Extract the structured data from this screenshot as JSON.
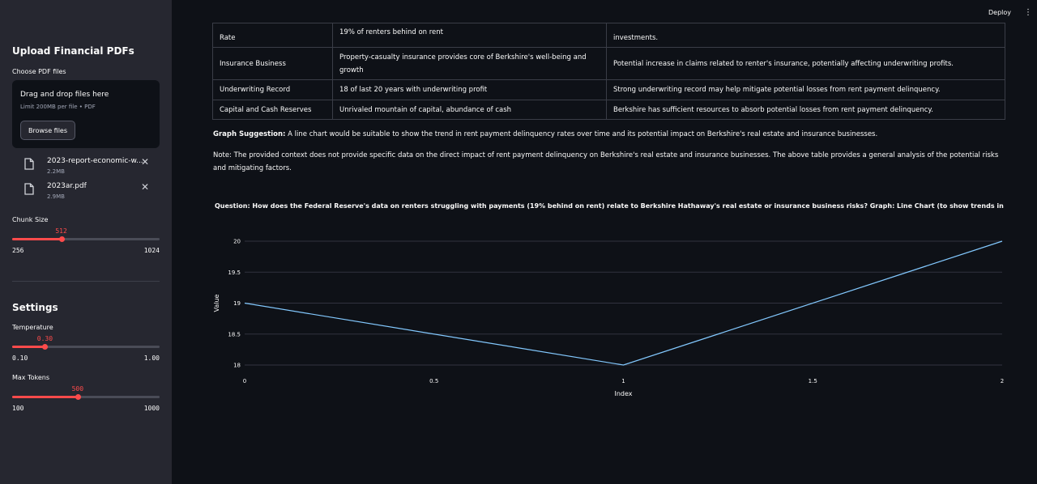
{
  "header": {
    "deploy_label": "Deploy",
    "menu_icon": "kebab-menu-icon"
  },
  "sidebar": {
    "title": "Upload Financial PDFs",
    "uploader": {
      "label": "Choose PDF files",
      "drop_text": "Drag and drop files here",
      "limit_text": "Limit 200MB per file • PDF",
      "browse_label": "Browse files"
    },
    "files": [
      {
        "name": "2023-report-economic-w...",
        "size": "2.2MB"
      },
      {
        "name": "2023ar.pdf",
        "size": "2.9MB"
      }
    ],
    "chunk_size": {
      "label": "Chunk Size",
      "value": "512",
      "min": "256",
      "max": "1024",
      "fraction": 0.333
    },
    "settings_title": "Settings",
    "temperature": {
      "label": "Temperature",
      "value": "0.30",
      "min": "0.10",
      "max": "1.00",
      "fraction": 0.222
    },
    "max_tokens": {
      "label": "Max Tokens",
      "value": "500",
      "min": "100",
      "max": "1000",
      "fraction": 0.444
    }
  },
  "main": {
    "table": [
      [
        "Rate",
        "19% of renters behind on rent",
        "investments."
      ],
      [
        "Insurance Business",
        "Property-casualty insurance provides core of Berkshire's well-being and growth",
        "Potential increase in claims related to renter's insurance, potentially affecting underwriting profits."
      ],
      [
        "Underwriting Record",
        "18 of last 20 years with underwriting profit",
        "Strong underwriting record may help mitigate potential losses from rent payment delinquency."
      ],
      [
        "Capital and Cash Reserves",
        "Unrivaled mountain of capital, abundance of cash",
        "Berkshire has sufficient resources to absorb potential losses from rent payment delinquency."
      ]
    ],
    "graph_suggestion_label": "Graph Suggestion:",
    "graph_suggestion_text": " A line chart would be suitable to show the trend in rent payment delinquency rates over time and its potential impact on Berkshire's real estate and insurance businesses.",
    "note": "Note: The provided context does not provide specific data on the direct impact of rent payment delinquency on Berkshire's real estate and insurance businesses. The above table provides a general analysis of the potential risks and mitigating factors."
  },
  "chart_data": {
    "type": "line",
    "title": "Question: How does the Federal Reserve's data on renters struggling with payments (19% behind on rent) relate to Berkshire Hathaway's real estate or insurance business risks?  Graph: Line Chart (to show trends in rent pa",
    "xlabel": "Index",
    "ylabel": "Value",
    "x": [
      0,
      1,
      2
    ],
    "y": [
      19,
      18,
      20
    ],
    "xticks": [
      "0",
      "0.5",
      "1",
      "1.5",
      "2"
    ],
    "yticks": [
      "18",
      "18.5",
      "19",
      "19.5",
      "20"
    ],
    "xlim": [
      0,
      2
    ],
    "ylim": [
      18,
      20
    ],
    "grid": true,
    "line_color": "#83c9ff",
    "grid_color": "#31333f"
  }
}
